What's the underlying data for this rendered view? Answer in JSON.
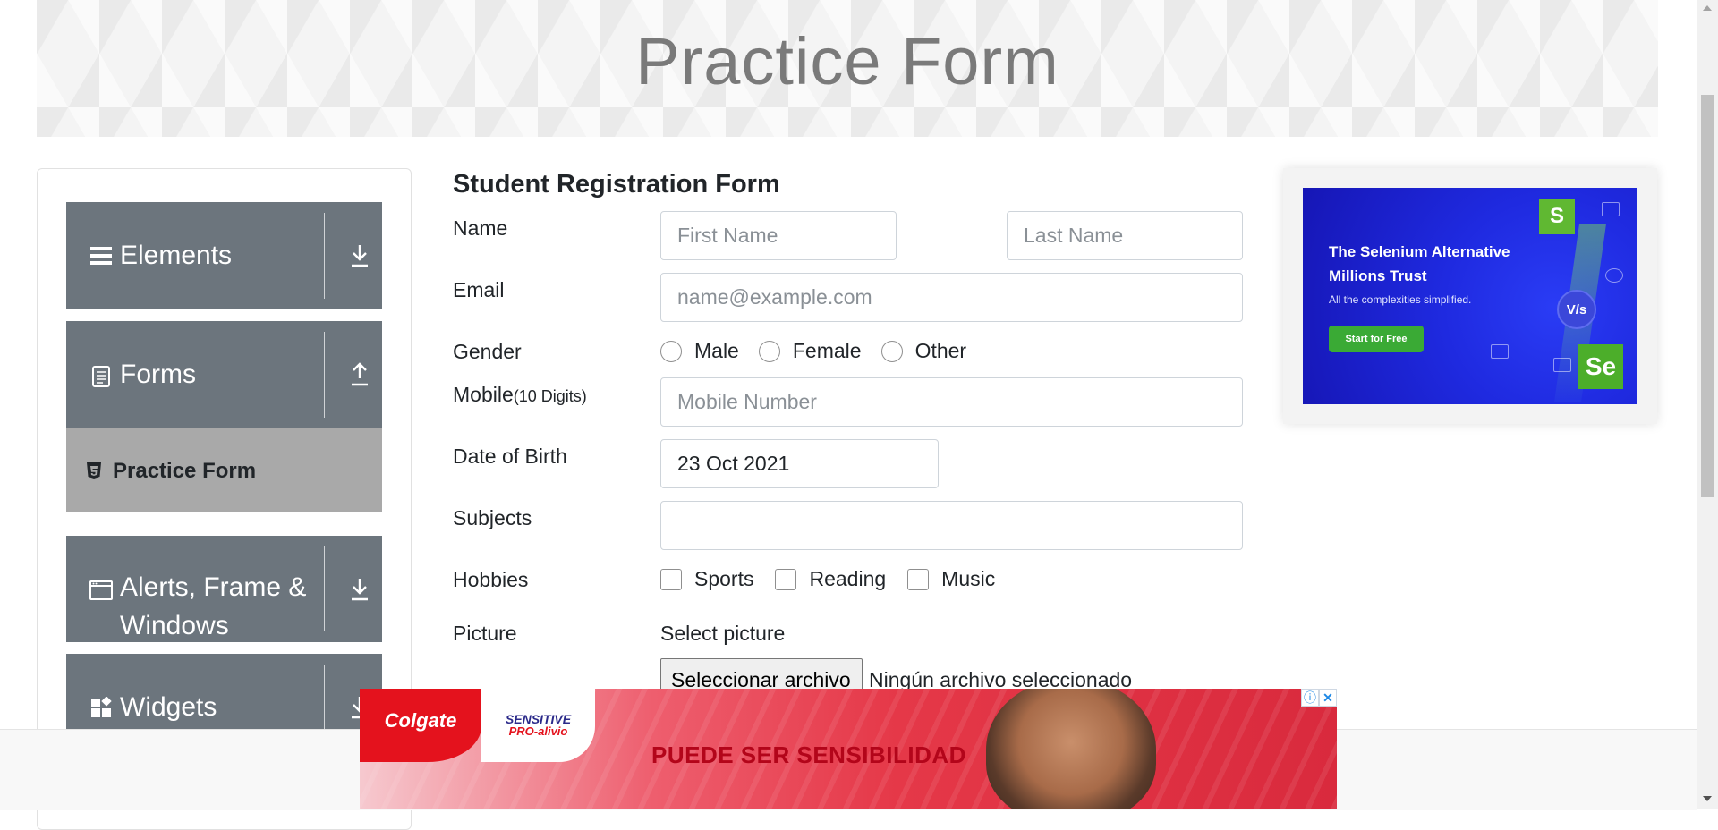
{
  "header": {
    "title": "Practice Form"
  },
  "sidebar": {
    "groups": [
      {
        "label": "Elements",
        "icon": "menu-icon",
        "arrow": "download-icon"
      },
      {
        "label": "Forms",
        "icon": "document-icon",
        "arrow": "upload-icon"
      },
      {
        "label": "Alerts, Frame & Windows",
        "icon": "window-icon",
        "arrow": "download-icon"
      },
      {
        "label": "Widgets",
        "icon": "widgets-icon",
        "arrow": "download-icon"
      }
    ],
    "active_item": {
      "label": "Practice Form",
      "icon": "html5-icon"
    }
  },
  "form": {
    "title": "Student Registration Form",
    "name_label": "Name",
    "first_name_placeholder": "First Name",
    "last_name_placeholder": "Last Name",
    "email_label": "Email",
    "email_placeholder": "name@example.com",
    "gender_label": "Gender",
    "gender_options": [
      "Male",
      "Female",
      "Other"
    ],
    "mobile_label": "Mobile",
    "mobile_hint": "(10 Digits)",
    "mobile_placeholder": "Mobile Number",
    "dob_label": "Date of Birth",
    "dob_value": "23 Oct 2021",
    "subjects_label": "Subjects",
    "subjects_value": "",
    "hobbies_label": "Hobbies",
    "hobbies_options": [
      "Sports",
      "Reading",
      "Music"
    ],
    "picture_label": "Picture",
    "picture_prompt": "Select picture",
    "file_button": "Seleccionar archivo",
    "file_status": "Ningún archivo seleccionado"
  },
  "right_ad": {
    "headline_line1": "The Selenium Alternative",
    "headline_line2": "Millions Trust",
    "subtext": "All the complexities simplified.",
    "button": "Start for Free",
    "badge_s": "S",
    "badge_se": "Se",
    "badge_vs": "V/s",
    "accent_color": "#2a3cf5",
    "button_color": "#3aaa35"
  },
  "bottom_ad": {
    "brand": "Colgate",
    "product_line1": "SENSITIVE",
    "product_line2": "PRO-alivio",
    "headline": "PUEDE SER SENSIBILIDAD",
    "info_glyph": "ⓘ",
    "close_glyph": "✕",
    "accent_color": "#e4121d"
  },
  "colors": {
    "sidebar_group_bg": "#6c757d",
    "active_item_bg": "#a9a9a9"
  }
}
